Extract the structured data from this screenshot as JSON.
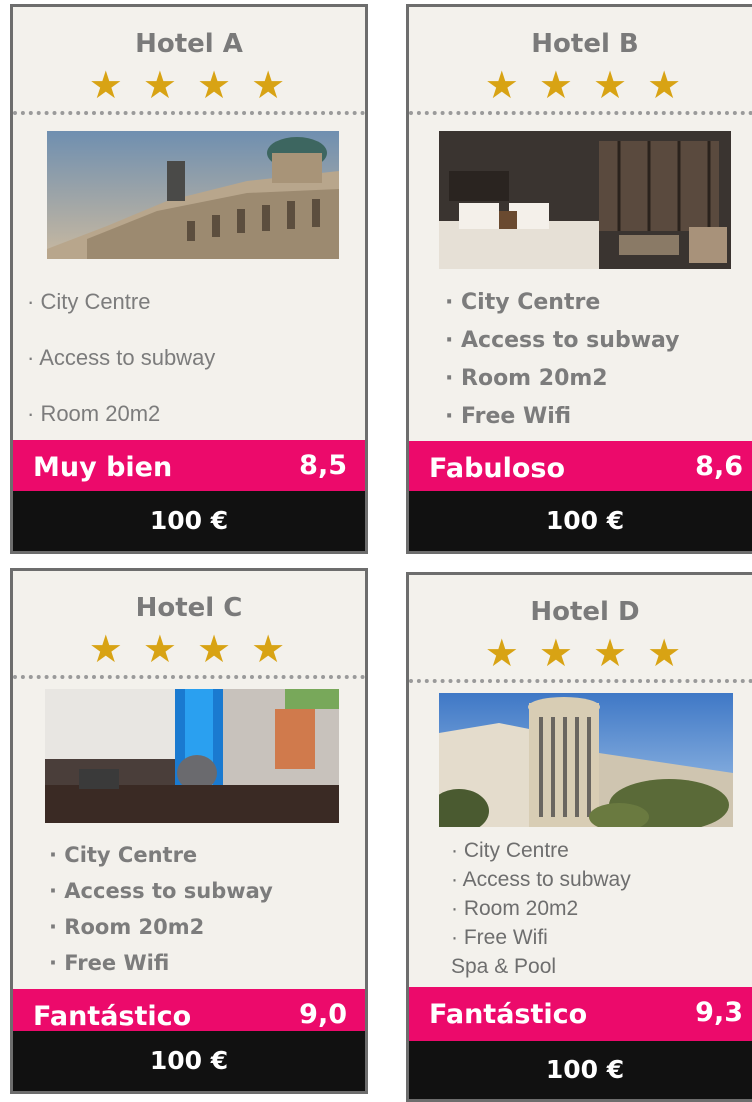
{
  "hotels": [
    {
      "name": "Hotel A",
      "stars": "★ ★ ★ ★",
      "features": [
        "· City Centre",
        "· Access to subway",
        "· Room 20m2"
      ],
      "rating_label": "Muy bien",
      "rating_score": "8,5",
      "price": "100 €"
    },
    {
      "name": "Hotel B",
      "stars": "★ ★ ★ ★",
      "features": [
        "· City Centre",
        "· Access to subway",
        "· Room 20m2",
        "· Free Wifi"
      ],
      "rating_label": "Fabuloso",
      "rating_score": "8,6",
      "price": "100 €"
    },
    {
      "name": "Hotel C",
      "stars": "★ ★ ★ ★",
      "features": [
        "· City Centre",
        "· Access to subway",
        "· Room 20m2",
        "· Free Wifi"
      ],
      "rating_label": "Fantástico",
      "rating_score": "9,0",
      "price": "100 €"
    },
    {
      "name": "Hotel D",
      "stars": "★ ★ ★ ★",
      "features": [
        "· City Centre",
        "· Access to subway",
        "· Room 20m2",
        "· Free Wifi",
        "Spa & Pool"
      ],
      "rating_label": "Fantástico",
      "rating_score": "9,3",
      "price": "100 €"
    }
  ],
  "colors": {
    "card_bg": "#f3f1ec",
    "rating_bar": "#ec0a6b",
    "price_bar": "#111111",
    "stars": "#d8a314",
    "title": "#7a7a7a"
  }
}
